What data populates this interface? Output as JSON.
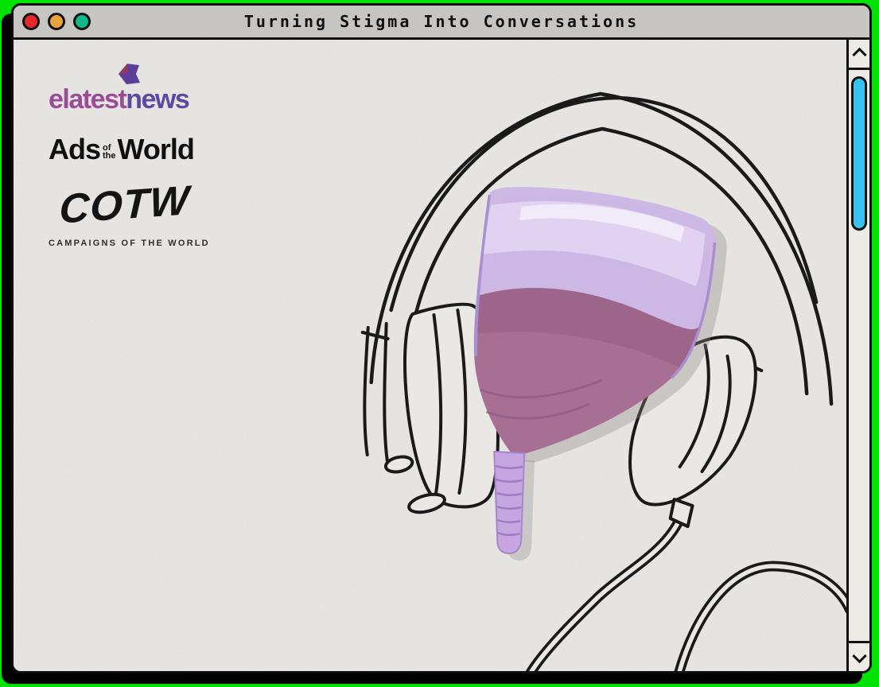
{
  "window": {
    "title": "Turning Stigma Into Conversations",
    "traffic_lights": [
      {
        "name": "close",
        "color": "#e8272b"
      },
      {
        "name": "minimize",
        "color": "#eaa33c"
      },
      {
        "name": "zoom",
        "color": "#14b789"
      }
    ],
    "titlebar_color": "#c6c5c2",
    "desktop_background": "#00e203"
  },
  "content": {
    "paper_color": "#eae8e4",
    "logos": {
      "elatestnews": {
        "part1": "elatest",
        "part2": "news",
        "part1_color": "#9a4c96",
        "part2_color": "#5a4aa0",
        "icon": "flag-chevron-icon",
        "icon_color": "#5d3e99"
      },
      "ads_of_the_world": {
        "word1": "Ads",
        "middle_top": "of",
        "middle_bottom": "the",
        "word2": "World",
        "color": "#101010"
      },
      "cotw": {
        "wordmark": "COTW",
        "tagline": "CAMPAIGNS OF THE WORLD",
        "color": "#141414"
      }
    },
    "illustration": {
      "name": "headphones-with-menstrual-cup",
      "description": "Hand-drawn black line-art headphones; a translucent purple menstrual cup holding fluid sits where the head would be",
      "colors": {
        "line": "#1a1a1a",
        "cup_body": "#cdb6e6",
        "cup_rim": "#e3d7f2",
        "fluid": "#a86f94",
        "stem": "#c6a5e1"
      }
    }
  },
  "scrollbar": {
    "up_icon": "chevron-up-icon",
    "down_icon": "chevron-down-icon",
    "thumb_color": "#38c2f3"
  }
}
